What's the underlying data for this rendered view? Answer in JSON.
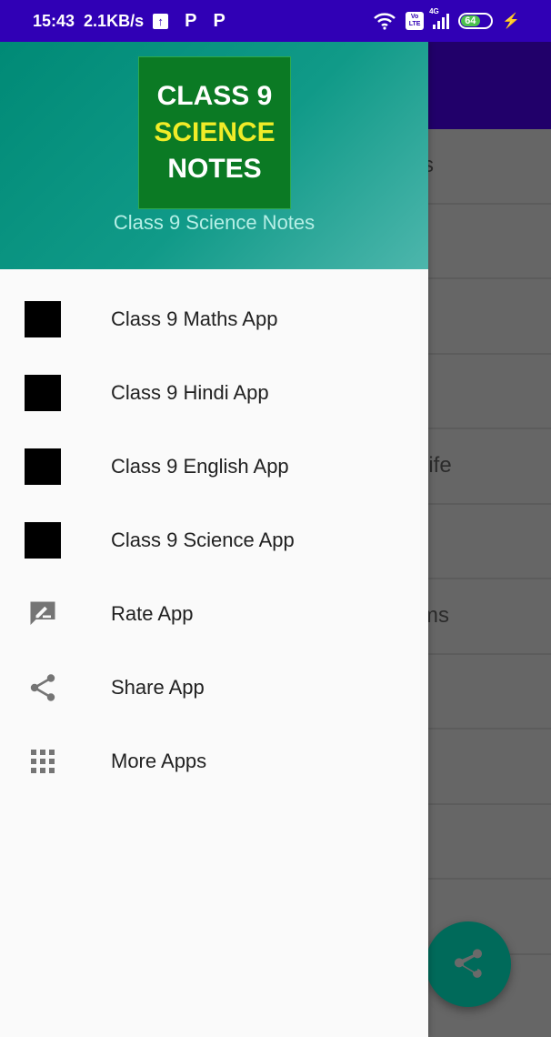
{
  "status_bar": {
    "time": "15:43",
    "network_speed": "2.1KB/s",
    "upload_icon": "upload-arrow-icon",
    "notification_icons": [
      "P",
      "P"
    ],
    "volte": [
      "Vo",
      "LTE"
    ],
    "network_type": "4G",
    "battery_level": "64",
    "charging": true
  },
  "drawer": {
    "logo": {
      "line1": "CLASS 9",
      "line2": "SCIENCE",
      "line3": "NOTES"
    },
    "app_name": "Class 9 Science Notes",
    "items": [
      {
        "label": "Class 9 Maths App",
        "icon": "app-thumbnail-icon"
      },
      {
        "label": "Class 9 Hindi App",
        "icon": "app-thumbnail-icon"
      },
      {
        "label": "Class 9 English App",
        "icon": "app-thumbnail-icon"
      },
      {
        "label": "Class 9 Science App",
        "icon": "app-thumbnail-icon"
      },
      {
        "label": "Rate App",
        "icon": "rate-review-icon"
      },
      {
        "label": "Share App",
        "icon": "share-icon"
      },
      {
        "label": "More Apps",
        "icon": "apps-grid-icon"
      }
    ]
  },
  "background_list": {
    "visible_fragments": [
      "s",
      "",
      "",
      "",
      "Life",
      "",
      "ms",
      "",
      "",
      "",
      ""
    ]
  },
  "colors": {
    "status_bar": "#3000b5",
    "toolbar": "#21006a",
    "header_gradient_start": "#008a76",
    "header_gradient_end": "#4db6ac",
    "logo_bg": "#0b7a24",
    "logo_accent": "#f0ec28",
    "fab": "#006a5a"
  }
}
